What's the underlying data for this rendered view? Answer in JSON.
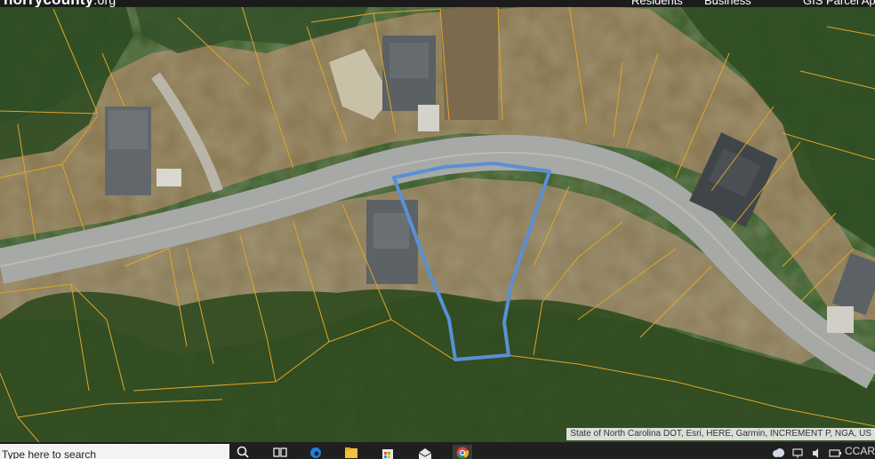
{
  "site": {
    "brand_main": "horrycounty",
    "brand_tld": ".org",
    "nav": [
      "Residents",
      "Business",
      "GIS Parcel Ap"
    ]
  },
  "map": {
    "attribution": "State of North Carolina DOT, Esri, HERE, Garmin, INCREMENT P, NGA, US",
    "selected_parcel_color": "#5b8fd6",
    "parcel_line_color": "#e0a52a",
    "road_color": "#a7a9a6"
  },
  "taskbar": {
    "search_placeholder": "Type here to search",
    "icons": [
      "search-icon",
      "task-view-icon",
      "edge-icon",
      "file-explorer-icon",
      "store-icon",
      "mail-icon",
      "chrome-icon"
    ],
    "tray": {
      "weather_icon": "cloud-icon",
      "text": "CCAR"
    }
  }
}
